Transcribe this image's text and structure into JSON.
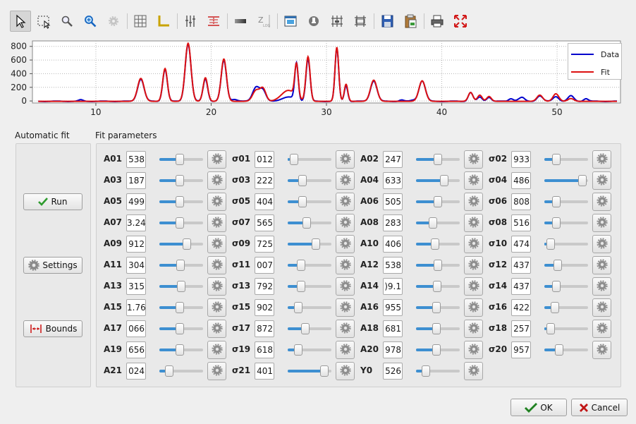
{
  "toolbar": {
    "tools": [
      "pointer-icon",
      "select-rect-icon",
      "zoom-icon",
      "zoom-fit-icon",
      "settings-gear-icon",
      "grid-icon",
      "axis-icon",
      "vertical-bars-icon",
      "range-icon",
      "gradient-bar-icon",
      "z-log-icon",
      "image-icon",
      "export-icon",
      "markers-icon",
      "markers-alt-icon",
      "save-icon",
      "paste-icon",
      "print-icon",
      "fullscreen-icon"
    ]
  },
  "chart_data": {
    "type": "line",
    "xlim": [
      4.5,
      55.5
    ],
    "ylim": [
      -30,
      880
    ],
    "x_ticks": [
      "10",
      "20",
      "30",
      "40",
      "50"
    ],
    "y_ticks": [
      "0",
      "200",
      "400",
      "600",
      "800"
    ],
    "grid": true,
    "legend_position": "top-right",
    "peaks": [
      {
        "x": 13.9,
        "fit": 335,
        "data": 325,
        "w": 0.28
      },
      {
        "x": 16.0,
        "fit": 480,
        "data": 470,
        "w": 0.2
      },
      {
        "x": 18.0,
        "fit": 850,
        "data": 840,
        "w": 0.25
      },
      {
        "x": 19.5,
        "fit": 345,
        "data": 330,
        "w": 0.2
      },
      {
        "x": 21.1,
        "fit": 620,
        "data": 600,
        "w": 0.23
      },
      {
        "x": 23.9,
        "fit": 160,
        "data": 210,
        "w": 0.3
      },
      {
        "x": 24.5,
        "fit": 180,
        "data": 150,
        "w": 0.25
      },
      {
        "x": 26.7,
        "fit": 160,
        "data": 60,
        "w": 0.6
      },
      {
        "x": 27.4,
        "fit": 480,
        "data": 540,
        "w": 0.15
      },
      {
        "x": 28.4,
        "fit": 650,
        "data": 620,
        "w": 0.18
      },
      {
        "x": 30.9,
        "fit": 790,
        "data": 770,
        "w": 0.16
      },
      {
        "x": 31.7,
        "fit": 250,
        "data": 230,
        "w": 0.15
      },
      {
        "x": 34.1,
        "fit": 310,
        "data": 300,
        "w": 0.28
      },
      {
        "x": 38.3,
        "fit": 300,
        "data": 300,
        "w": 0.28
      },
      {
        "x": 42.5,
        "fit": 130,
        "data": 130,
        "w": 0.2
      },
      {
        "x": 43.3,
        "fit": 90,
        "data": 60,
        "w": 0.2
      },
      {
        "x": 44.1,
        "fit": 70,
        "data": 60,
        "w": 0.2
      },
      {
        "x": 48.5,
        "fit": 90,
        "data": 80,
        "w": 0.25
      },
      {
        "x": 49.9,
        "fit": 110,
        "data": 70,
        "w": 0.25
      },
      {
        "x": 51.2,
        "fit": 40,
        "data": 80,
        "w": 0.25
      }
    ],
    "series": [
      {
        "name": "Data",
        "color": "#0000cc"
      },
      {
        "name": "Fit",
        "color": "#dd1111"
      }
    ]
  },
  "auto_fit": {
    "title": "Automatic fit",
    "run": "Run",
    "settings": "Settings",
    "bounds": "Bounds"
  },
  "fit_params": {
    "title": "Fit parameters",
    "rows": [
      [
        {
          "label": "A01",
          "value": "538",
          "pos": 0.45
        },
        {
          "label": "σ01",
          "value": "012",
          "pos": 0.05
        },
        {
          "label": "A02",
          "value": "247",
          "pos": 0.5
        },
        {
          "label": "σ02",
          "value": "933",
          "pos": 0.22
        }
      ],
      [
        {
          "label": "A03",
          "value": "187",
          "pos": 0.45
        },
        {
          "label": "σ03",
          "value": "222",
          "pos": 0.3
        },
        {
          "label": "A04",
          "value": "633",
          "pos": 0.68
        },
        {
          "label": "σ04",
          "value": "486",
          "pos": 0.95
        }
      ],
      [
        {
          "label": "A05",
          "value": "499",
          "pos": 0.45
        },
        {
          "label": "σ05",
          "value": "404",
          "pos": 0.3
        },
        {
          "label": "A06",
          "value": "505",
          "pos": 0.5
        },
        {
          "label": "σ06",
          "value": "808",
          "pos": 0.22
        }
      ],
      [
        {
          "label": "A07",
          "value": "3.24",
          "pos": 0.45
        },
        {
          "label": "σ07",
          "value": "565",
          "pos": 0.42
        },
        {
          "label": "A08",
          "value": "283",
          "pos": 0.35
        },
        {
          "label": "σ08",
          "value": "516",
          "pos": 0.22
        }
      ],
      [
        {
          "label": "A09",
          "value": "912",
          "pos": 0.65
        },
        {
          "label": "σ09",
          "value": "725",
          "pos": 0.68
        },
        {
          "label": "A10",
          "value": "406",
          "pos": 0.42
        },
        {
          "label": "σ10",
          "value": "474",
          "pos": 0.05
        }
      ],
      [
        {
          "label": "A11",
          "value": "304",
          "pos": 0.48
        },
        {
          "label": "σ11",
          "value": "007",
          "pos": 0.25
        },
        {
          "label": "A12",
          "value": "538",
          "pos": 0.5
        },
        {
          "label": "σ12",
          "value": "437",
          "pos": 0.25
        }
      ],
      [
        {
          "label": "A13",
          "value": "315",
          "pos": 0.5
        },
        {
          "label": "σ13",
          "value": "792",
          "pos": 0.25
        },
        {
          "label": "A14",
          "value": ")9.1",
          "pos": 0.48
        },
        {
          "label": "σ14",
          "value": "437",
          "pos": 0.22
        }
      ],
      [
        {
          "label": "A15",
          "value": "1.76",
          "pos": 0.45
        },
        {
          "label": "σ15",
          "value": "902",
          "pos": 0.18
        },
        {
          "label": "A16",
          "value": "955",
          "pos": 0.45
        },
        {
          "label": "σ16",
          "value": "422",
          "pos": 0.18
        }
      ],
      [
        {
          "label": "A17",
          "value": "066",
          "pos": 0.45
        },
        {
          "label": "σ17",
          "value": "872",
          "pos": 0.37
        },
        {
          "label": "A18",
          "value": "681",
          "pos": 0.45
        },
        {
          "label": "σ18",
          "value": "257",
          "pos": 0.05
        }
      ],
      [
        {
          "label": "A19",
          "value": "656",
          "pos": 0.45
        },
        {
          "label": "σ19",
          "value": "618",
          "pos": 0.18
        },
        {
          "label": "A20",
          "value": "978",
          "pos": 0.45
        },
        {
          "label": "σ20",
          "value": "957",
          "pos": 0.3
        }
      ],
      [
        {
          "label": "A21",
          "value": "024",
          "pos": 0.15
        },
        {
          "label": "σ21",
          "value": "401",
          "pos": 0.92
        },
        {
          "label": "Y0",
          "value": "526",
          "pos": 0.15
        }
      ]
    ]
  },
  "dialog": {
    "ok": "OK",
    "cancel": "Cancel"
  }
}
